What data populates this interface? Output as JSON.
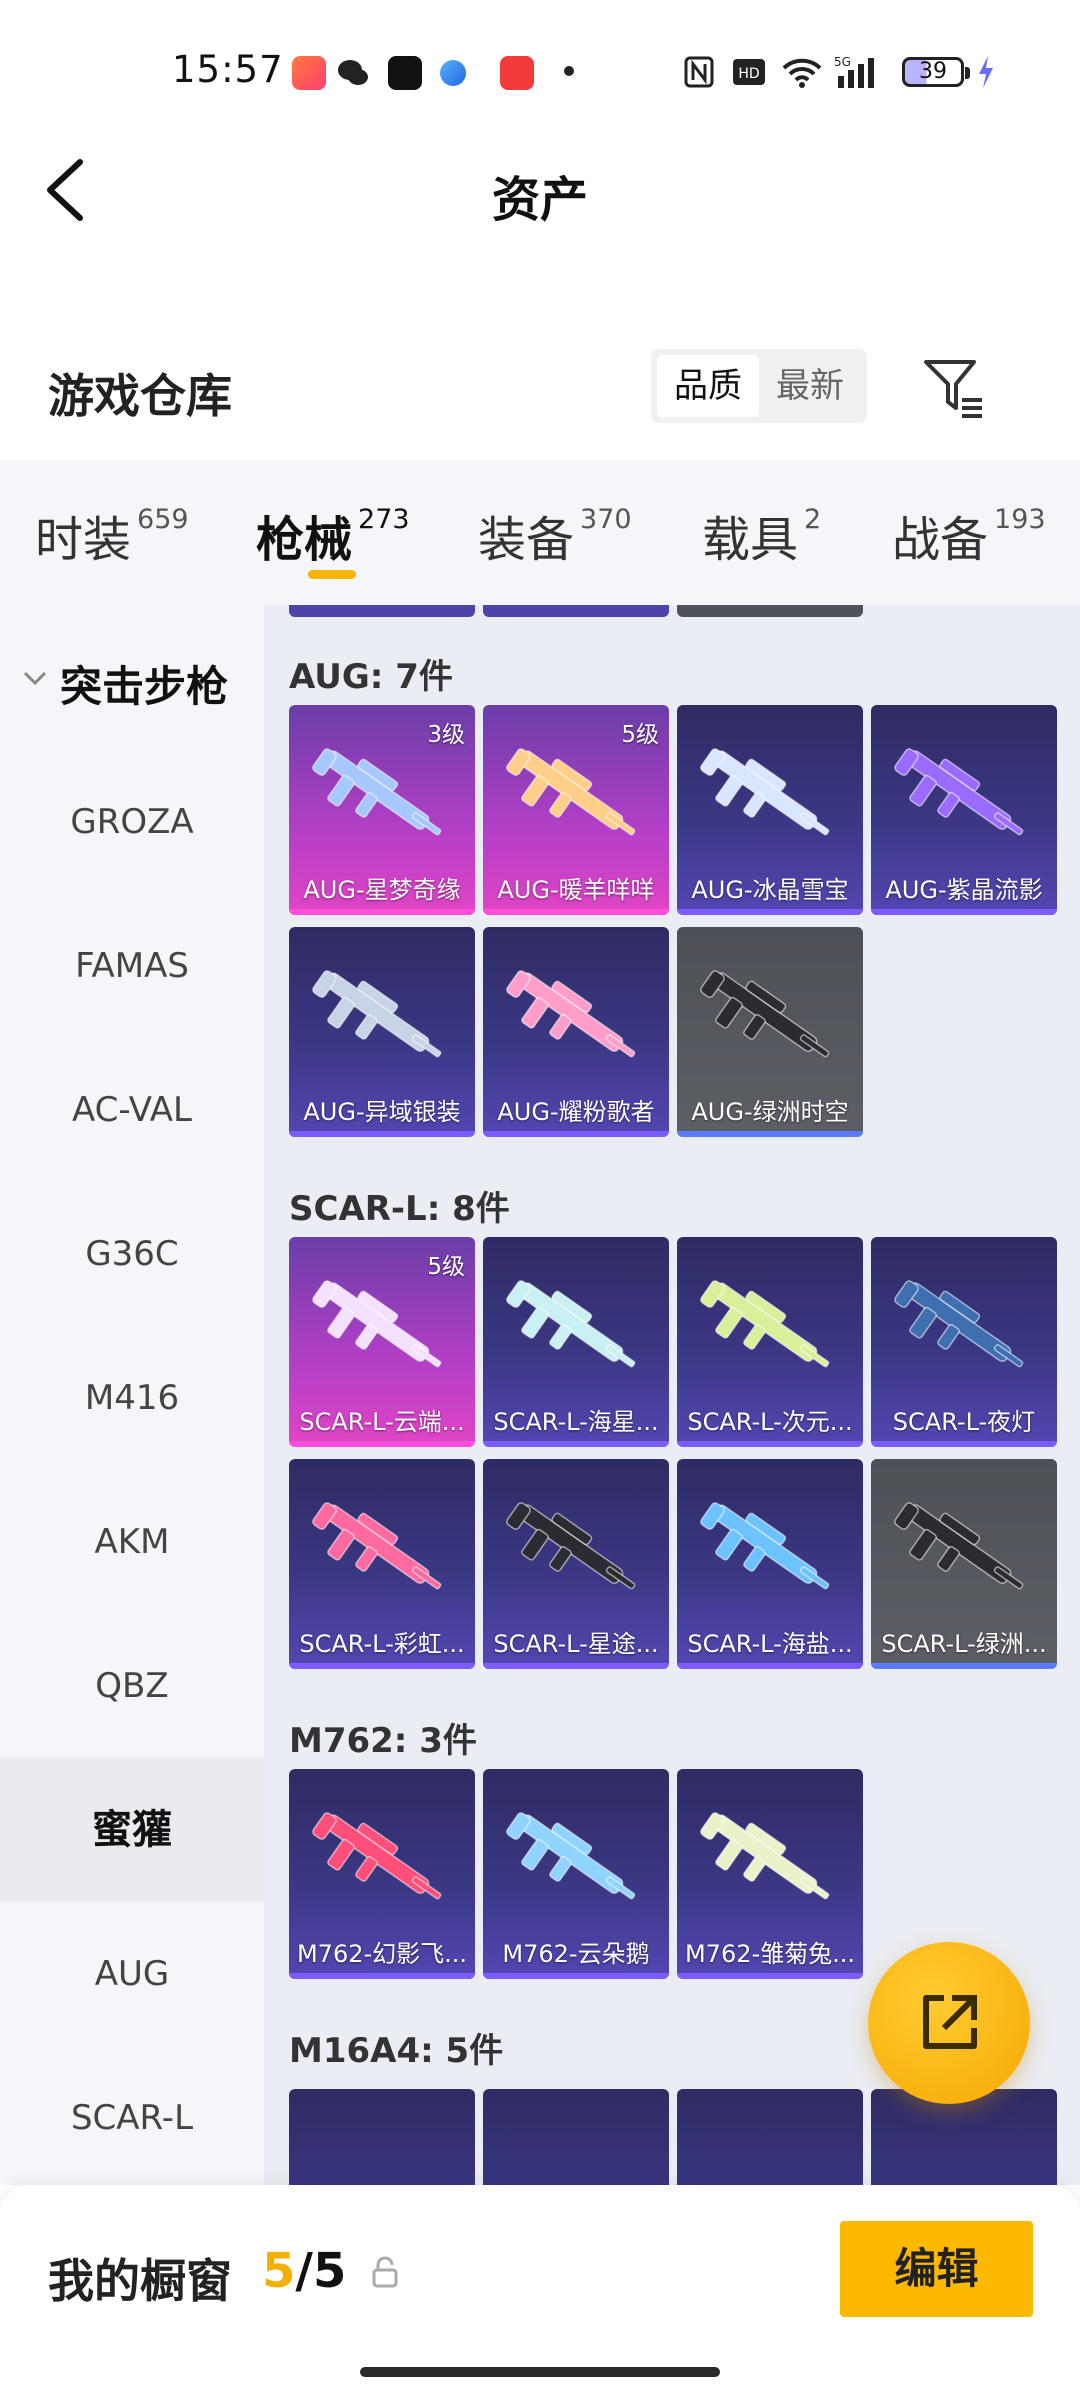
{
  "status_bar": {
    "time": "15:57",
    "battery": "39"
  },
  "header": {
    "title": "资产"
  },
  "warehouse": {
    "title": "游戏仓库",
    "sort_options": [
      "品质",
      "最新"
    ],
    "active_sort": "品质"
  },
  "tabs": [
    {
      "label": "时装",
      "count": "659"
    },
    {
      "label": "枪械",
      "count": "273"
    },
    {
      "label": "装备",
      "count": "370"
    },
    {
      "label": "载具",
      "count": "2"
    },
    {
      "label": "战备",
      "count": "193"
    }
  ],
  "sidebar": {
    "category": "突击步枪",
    "items": [
      "GROZA",
      "FAMAS",
      "AC-VAL",
      "G36C",
      "M416",
      "AKM",
      "QBZ",
      "蜜獾",
      "AUG",
      "SCAR-L"
    ],
    "active": "蜜獾"
  },
  "sections": [
    {
      "title": "AUG: 7件",
      "items": [
        {
          "name": "AUG-星梦奇缘",
          "level": "3级",
          "rarity": "pink",
          "color": "#a6c8ff"
        },
        {
          "name": "AUG-暖羊咩咩",
          "level": "5级",
          "rarity": "pink",
          "color": "#ffcf8a"
        },
        {
          "name": "AUG-冰晶雪宝",
          "level": "",
          "rarity": "purple",
          "color": "#d9e6ff"
        },
        {
          "name": "AUG-紫晶流影",
          "level": "",
          "rarity": "purple",
          "color": "#9b6bff"
        },
        {
          "name": "AUG-异域银装",
          "level": "",
          "rarity": "purple",
          "color": "#c7d3e6"
        },
        {
          "name": "AUG-耀粉歌者",
          "level": "",
          "rarity": "purple",
          "color": "#ff9ec8"
        },
        {
          "name": "AUG-绿洲时空",
          "level": "",
          "rarity": "grey",
          "color": "#2a2c31"
        }
      ]
    },
    {
      "title": "SCAR-L: 8件",
      "items": [
        {
          "name": "SCAR-L-云端...",
          "level": "5级",
          "rarity": "pink",
          "color": "#f3e1ff"
        },
        {
          "name": "SCAR-L-海星...",
          "level": "",
          "rarity": "purple",
          "color": "#c9f0f2"
        },
        {
          "name": "SCAR-L-次元...",
          "level": "",
          "rarity": "purple",
          "color": "#d8f09a"
        },
        {
          "name": "SCAR-L-夜灯",
          "level": "",
          "rarity": "purple",
          "color": "#3f6fb0"
        },
        {
          "name": "SCAR-L-彩虹...",
          "level": "",
          "rarity": "purple",
          "color": "#ff6aa0"
        },
        {
          "name": "SCAR-L-星途...",
          "level": "",
          "rarity": "purple",
          "color": "#2b2b33"
        },
        {
          "name": "SCAR-L-海盐...",
          "level": "",
          "rarity": "purple",
          "color": "#6cc3ff"
        },
        {
          "name": "SCAR-L-绿洲...",
          "level": "",
          "rarity": "grey",
          "color": "#2a2c31"
        }
      ]
    },
    {
      "title": "M762: 3件",
      "items": [
        {
          "name": "M762-幻影飞...",
          "level": "",
          "rarity": "purple",
          "color": "#ff4f7a"
        },
        {
          "name": "M762-云朵鹅",
          "level": "",
          "rarity": "purple",
          "color": "#8fd3ff"
        },
        {
          "name": "M762-雏菊兔...",
          "level": "",
          "rarity": "purple",
          "color": "#e9f2c8"
        }
      ]
    },
    {
      "title": "M16A4: 5件",
      "items": []
    }
  ],
  "showcase": {
    "label": "我的橱窗",
    "current": "5",
    "total": "/5",
    "edit_label": "编辑"
  },
  "colors": {
    "accent": "#f7b500",
    "pink_rarity": "#e244c6",
    "purple_rarity": "#5347b3"
  }
}
